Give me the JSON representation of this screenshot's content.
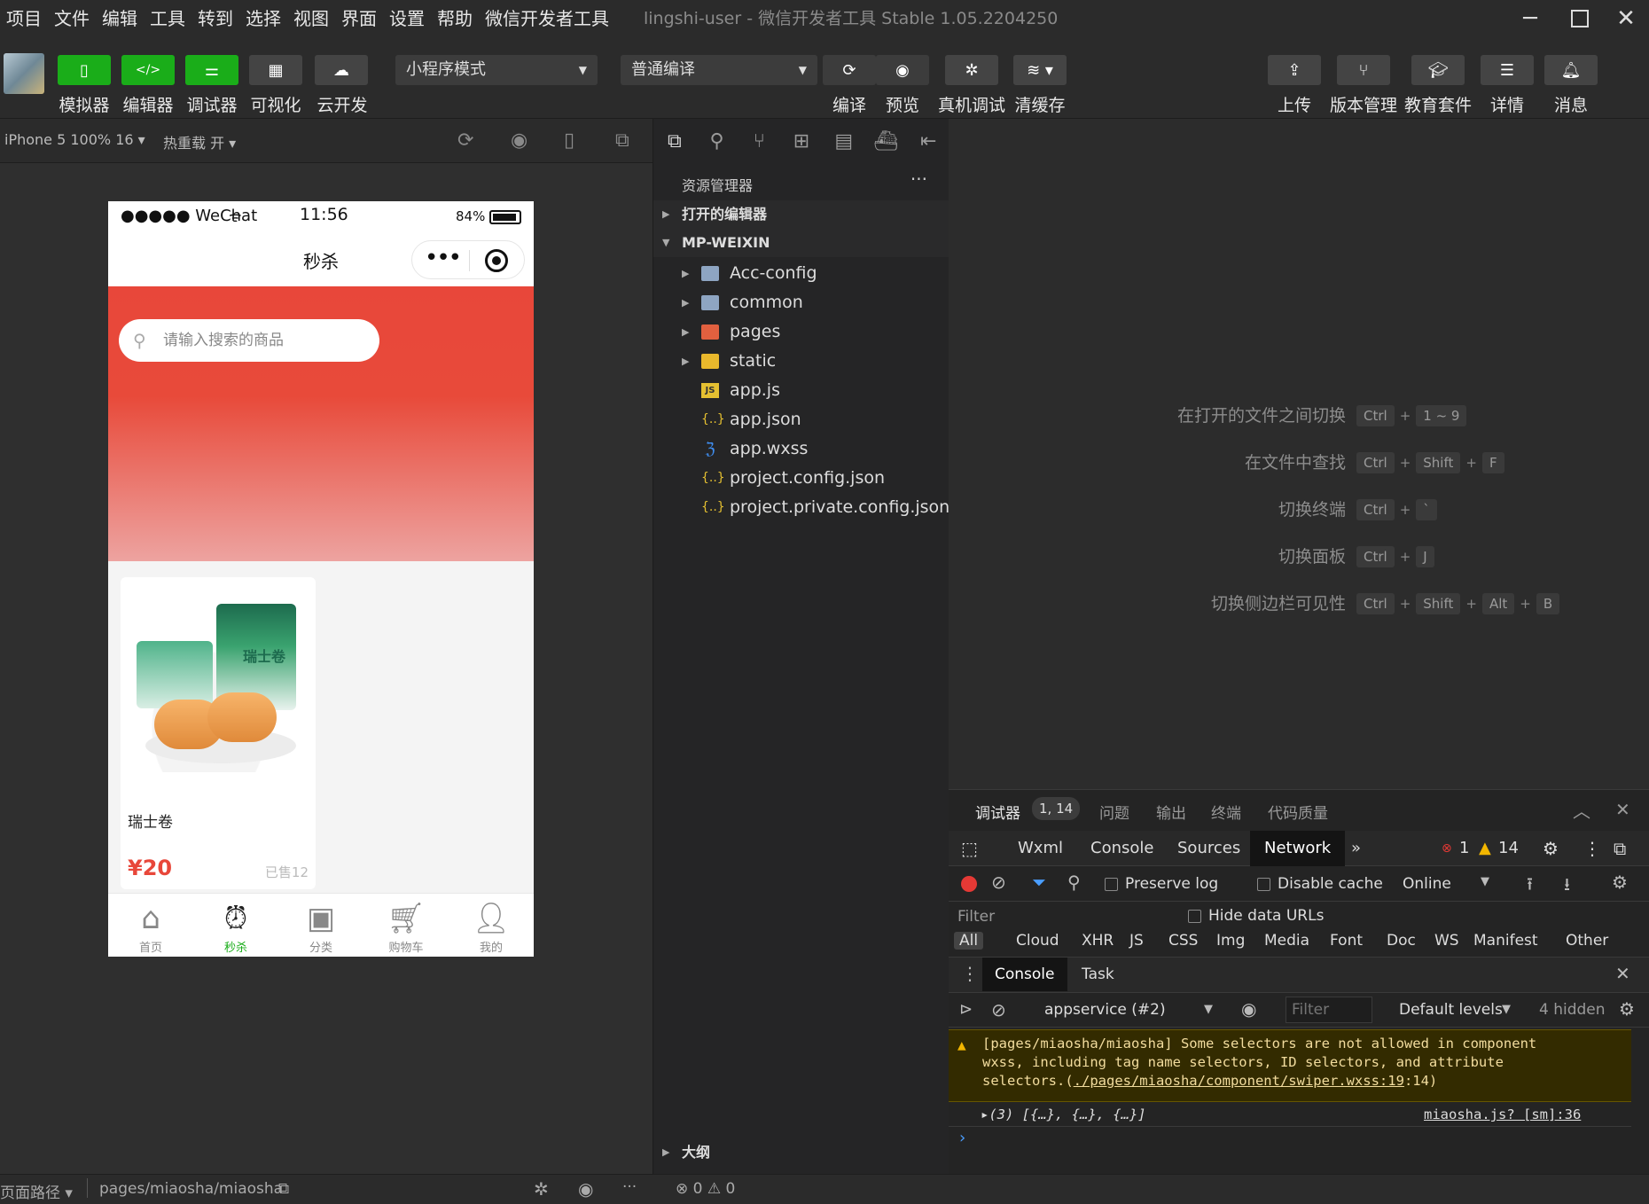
{
  "menu": [
    "项目",
    "文件",
    "编辑",
    "工具",
    "转到",
    "选择",
    "视图",
    "界面",
    "设置",
    "帮助",
    "微信开发者工具"
  ],
  "window_title": "lingshi-user - 微信开发者工具 Stable 1.05.2204250",
  "toolbar": {
    "left_buttons": [
      "模拟器",
      "编辑器",
      "调试器",
      "可视化",
      "云开发"
    ],
    "mode_select": "小程序模式",
    "compile_select": "普通编译",
    "mid_buttons": [
      "编译",
      "预览",
      "真机调试",
      "清缓存"
    ],
    "right_buttons": [
      "上传",
      "版本管理",
      "教育套件",
      "详情",
      "消息"
    ]
  },
  "simbar": {
    "device": "iPhone 5 100% 16 ▾",
    "hotreload": "热重载 开 ▾"
  },
  "phone": {
    "status": {
      "signal": "●●●●● WeChat",
      "time": "11:56",
      "battery": "84%"
    },
    "nav_title": "秒杀",
    "search_placeholder": "请输入搜索的商品",
    "product": {
      "name": "瑞士卷",
      "price": "¥20",
      "sold": "已售12",
      "package_text": "瑞士卷"
    },
    "tabs": [
      {
        "label": "首页",
        "icon": "home-icon"
      },
      {
        "label": "秒杀",
        "icon": "alarm-clock-icon",
        "active": true
      },
      {
        "label": "分类",
        "icon": "category-icon"
      },
      {
        "label": "购物车",
        "icon": "cart-icon"
      },
      {
        "label": "我的",
        "icon": "user-icon"
      }
    ]
  },
  "explorer": {
    "title": "资源管理器",
    "more": "···",
    "open_editors": "打开的编辑器",
    "project": "MP-WEIXIN",
    "files": [
      {
        "name": "Acc-config",
        "type": "folder"
      },
      {
        "name": "common",
        "type": "folder"
      },
      {
        "name": "pages",
        "type": "folder-pages"
      },
      {
        "name": "static",
        "type": "folder-static"
      },
      {
        "name": "app.js",
        "type": "js"
      },
      {
        "name": "app.json",
        "type": "json"
      },
      {
        "name": "app.wxss",
        "type": "css"
      },
      {
        "name": "project.config.json",
        "type": "json"
      },
      {
        "name": "project.private.config.json",
        "type": "json"
      }
    ],
    "outline": "大纲",
    "problems": "⊗ 0 ⚠ 0"
  },
  "shortcuts": [
    {
      "label": "在打开的文件之间切换",
      "keys": [
        "Ctrl",
        "1 ~ 9"
      ]
    },
    {
      "label": "在文件中查找",
      "keys": [
        "Ctrl",
        "Shift",
        "F"
      ]
    },
    {
      "label": "切换终端",
      "keys": [
        "Ctrl",
        "`"
      ]
    },
    {
      "label": "切换面板",
      "keys": [
        "Ctrl",
        "J"
      ]
    },
    {
      "label": "切换侧边栏可见性",
      "keys": [
        "Ctrl",
        "Shift",
        "Alt",
        "B"
      ]
    }
  ],
  "devtools": {
    "tabs": [
      "调试器",
      "问题",
      "输出",
      "终端",
      "代码质量"
    ],
    "badge": "1, 14",
    "panels": [
      "Wxml",
      "Console",
      "Sources",
      "Network"
    ],
    "more": "»",
    "errors": "1",
    "warnings": "14",
    "preserve_log": "Preserve log",
    "disable_cache": "Disable cache",
    "throttle": "Online",
    "filter_label": "Filter",
    "hide_data_urls": "Hide data URLs",
    "types": [
      "All",
      "Cloud",
      "XHR",
      "JS",
      "CSS",
      "Img",
      "Media",
      "Font",
      "Doc",
      "WS",
      "Manifest",
      "Other"
    ],
    "console_tabs": [
      "Console",
      "Task"
    ],
    "context": "appservice (#2)",
    "console_filter_placeholder": "Filter",
    "levels": "Default levels",
    "hidden": "4 hidden",
    "warning_line1": "[pages/miaosha/miaosha] Some selectors are not allowed in component",
    "warning_line2": "wxss, including tag name selectors, ID selectors, and attribute",
    "warning_line3_prefix": "selectors.(",
    "warning_link": "./pages/miaosha/component/swiper.wxss:19",
    "warning_line3_suffix": ":14)",
    "log_value": "▸(3) [{…}, {…}, {…}]",
    "log_source": "miaosha.js? [sm]:36",
    "prompt": "›"
  },
  "statusline": {
    "path_label": "页面路径 ▾",
    "path": "pages/miaosha/miaosha"
  },
  "colors": {
    "green": "#1aad19",
    "red": "#e8473a",
    "bg": "#2c2c2c"
  }
}
